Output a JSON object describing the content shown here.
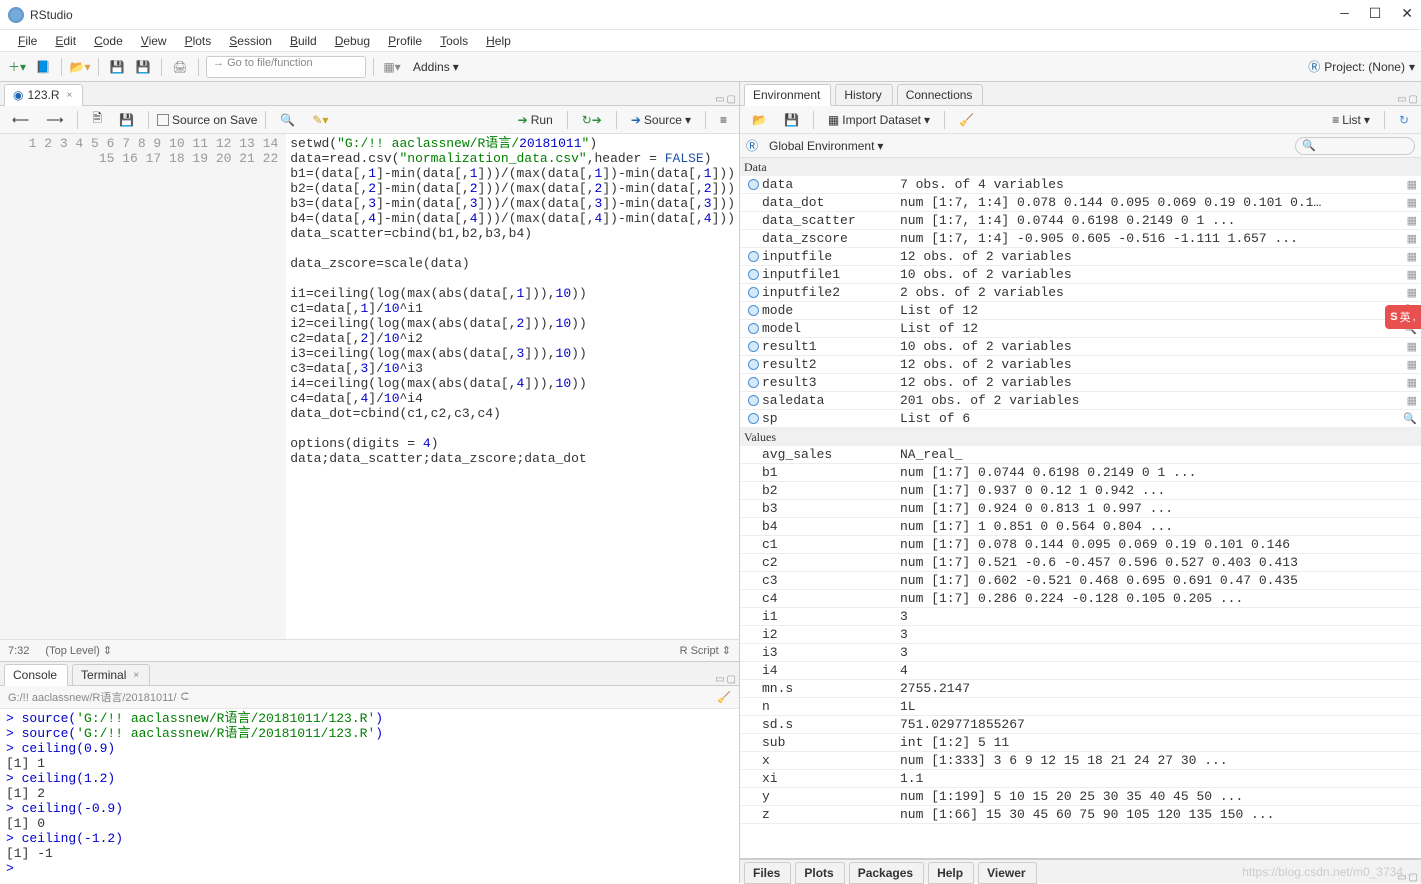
{
  "app": {
    "title": "RStudio"
  },
  "menubar": [
    "File",
    "Edit",
    "Code",
    "View",
    "Plots",
    "Session",
    "Build",
    "Debug",
    "Profile",
    "Tools",
    "Help"
  ],
  "toolbar": {
    "goto_placeholder": "Go to file/function",
    "addins_label": "Addins",
    "project_label": "Project: (None)"
  },
  "source": {
    "tab_name": "123.R",
    "source_on_save": "Source on Save",
    "run": "Run",
    "source_btn": "Source",
    "status_pos": "7:32",
    "status_scope": "(Top Level)",
    "status_lang": "R Script",
    "code": [
      {
        "n": 1,
        "raw": "setwd(\"G:/!! aaclassnew/R语言/20181011\")"
      },
      {
        "n": 2,
        "raw": "data=read.csv(\"normalization_data.csv\",header = FALSE)"
      },
      {
        "n": 3,
        "raw": "b1=(data[,1]-min(data[,1]))/(max(data[,1])-min(data[,1]))"
      },
      {
        "n": 4,
        "raw": "b2=(data[,2]-min(data[,2]))/(max(data[,2])-min(data[,2]))"
      },
      {
        "n": 5,
        "raw": "b3=(data[,3]-min(data[,3]))/(max(data[,3])-min(data[,3]))"
      },
      {
        "n": 6,
        "raw": "b4=(data[,4]-min(data[,4]))/(max(data[,4])-min(data[,4]))"
      },
      {
        "n": 7,
        "raw": "data_scatter=cbind(b1,b2,b3,b4)"
      },
      {
        "n": 8,
        "raw": ""
      },
      {
        "n": 9,
        "raw": "data_zscore=scale(data)"
      },
      {
        "n": 10,
        "raw": ""
      },
      {
        "n": 11,
        "raw": "i1=ceiling(log(max(abs(data[,1])),10))"
      },
      {
        "n": 12,
        "raw": "c1=data[,1]/10^i1"
      },
      {
        "n": 13,
        "raw": "i2=ceiling(log(max(abs(data[,2])),10))"
      },
      {
        "n": 14,
        "raw": "c2=data[,2]/10^i2"
      },
      {
        "n": 15,
        "raw": "i3=ceiling(log(max(abs(data[,3])),10))"
      },
      {
        "n": 16,
        "raw": "c3=data[,3]/10^i3"
      },
      {
        "n": 17,
        "raw": "i4=ceiling(log(max(abs(data[,4])),10))"
      },
      {
        "n": 18,
        "raw": "c4=data[,4]/10^i4"
      },
      {
        "n": 19,
        "raw": "data_dot=cbind(c1,c2,c3,c4)"
      },
      {
        "n": 20,
        "raw": ""
      },
      {
        "n": 21,
        "raw": "options(digits = 4)"
      },
      {
        "n": 22,
        "raw": "data;data_scatter;data_zscore;data_dot"
      }
    ]
  },
  "console": {
    "tabs": [
      "Console",
      "Terminal"
    ],
    "path": "G:/!! aaclassnew/R语言/20181011/",
    "lines": [
      {
        "t": "> source('G:/!! aaclassnew/R语言/20181011/123.R')",
        "c": "blue"
      },
      {
        "t": "> source('G:/!! aaclassnew/R语言/20181011/123.R')",
        "c": "blue"
      },
      {
        "t": "> ceiling(0.9)",
        "c": "blue"
      },
      {
        "t": "[1] 1",
        "c": "black"
      },
      {
        "t": "> ceiling(1.2)",
        "c": "blue"
      },
      {
        "t": "[1] 2",
        "c": "black"
      },
      {
        "t": "> ceiling(-0.9)",
        "c": "blue"
      },
      {
        "t": "[1] 0",
        "c": "black"
      },
      {
        "t": "> ceiling(-1.2)",
        "c": "blue"
      },
      {
        "t": "[1] -1",
        "c": "black"
      },
      {
        "t": "> ",
        "c": "blue"
      }
    ]
  },
  "env": {
    "tabs": [
      "Environment",
      "History",
      "Connections"
    ],
    "import_label": "Import Dataset",
    "list_label": "List",
    "scope_label": "Global Environment",
    "header_values": "Values",
    "data_rows": [
      {
        "ic": "o",
        "name": "data",
        "val": "7 obs. of 4 variables",
        "grid": true
      },
      {
        "ic": "",
        "name": "data_dot",
        "val": "num [1:7, 1:4] 0.078 0.144 0.095 0.069 0.19 0.101 0.1…",
        "grid": true
      },
      {
        "ic": "",
        "name": "data_scatter",
        "val": "num [1:7, 1:4] 0.0744 0.6198 0.2149 0 1 ...",
        "grid": true
      },
      {
        "ic": "",
        "name": "data_zscore",
        "val": "num [1:7, 1:4] -0.905 0.605 -0.516 -1.111 1.657 ...",
        "grid": true
      },
      {
        "ic": "o",
        "name": "inputfile",
        "val": "12 obs. of 2 variables",
        "grid": true
      },
      {
        "ic": "o",
        "name": "inputfile1",
        "val": "10 obs. of 2 variables",
        "grid": true
      },
      {
        "ic": "o",
        "name": "inputfile2",
        "val": "2 obs. of 2 variables",
        "grid": true
      },
      {
        "ic": "o",
        "name": "mode",
        "val": "List of 12",
        "mag": true
      },
      {
        "ic": "o",
        "name": "model",
        "val": "List of 12",
        "mag": true
      },
      {
        "ic": "o",
        "name": "result1",
        "val": "10 obs. of 2 variables",
        "grid": true
      },
      {
        "ic": "o",
        "name": "result2",
        "val": "12 obs. of 2 variables",
        "grid": true
      },
      {
        "ic": "o",
        "name": "result3",
        "val": "12 obs. of 2 variables",
        "grid": true
      },
      {
        "ic": "o",
        "name": "saledata",
        "val": "201 obs. of 2 variables",
        "grid": true
      },
      {
        "ic": "o",
        "name": "sp",
        "val": "List of 6",
        "mag": true
      }
    ],
    "value_rows": [
      {
        "name": "avg_sales",
        "val": "NA_real_"
      },
      {
        "name": "b1",
        "val": "num [1:7] 0.0744 0.6198 0.2149 0 1 ..."
      },
      {
        "name": "b2",
        "val": "num [1:7] 0.937 0 0.12 1 0.942 ..."
      },
      {
        "name": "b3",
        "val": "num [1:7] 0.924 0 0.813 1 0.997 ..."
      },
      {
        "name": "b4",
        "val": "num [1:7] 1 0.851 0 0.564 0.804 ..."
      },
      {
        "name": "c1",
        "val": "num [1:7] 0.078 0.144 0.095 0.069 0.19 0.101 0.146"
      },
      {
        "name": "c2",
        "val": "num [1:7] 0.521 -0.6 -0.457 0.596 0.527 0.403 0.413"
      },
      {
        "name": "c3",
        "val": "num [1:7] 0.602 -0.521 0.468 0.695 0.691 0.47 0.435"
      },
      {
        "name": "c4",
        "val": "num [1:7] 0.286 0.224 -0.128 0.105 0.205 ..."
      },
      {
        "name": "i1",
        "val": "3"
      },
      {
        "name": "i2",
        "val": "3"
      },
      {
        "name": "i3",
        "val": "3"
      },
      {
        "name": "i4",
        "val": "4"
      },
      {
        "name": "mn.s",
        "val": "2755.2147"
      },
      {
        "name": "n",
        "val": "1L"
      },
      {
        "name": "sd.s",
        "val": "751.029771855267"
      },
      {
        "name": "sub",
        "val": "int [1:2] 5 11"
      },
      {
        "name": "x",
        "val": "num [1:333] 3 6 9 12 15 18 21 24 27 30 ..."
      },
      {
        "name": "xi",
        "val": "1.1"
      },
      {
        "name": "y",
        "val": "num [1:199] 5 10 15 20 25 30 35 40 45 50 ..."
      },
      {
        "name": "z",
        "val": "num [1:66] 15 30 45 60 75 90 105 120 135 150 ..."
      }
    ]
  },
  "bottom_right_tabs": [
    "Files",
    "Plots",
    "Packages",
    "Help",
    "Viewer"
  ],
  "ime_text": "英",
  "watermark": "https://blog.csdn.net/m0_3734…"
}
